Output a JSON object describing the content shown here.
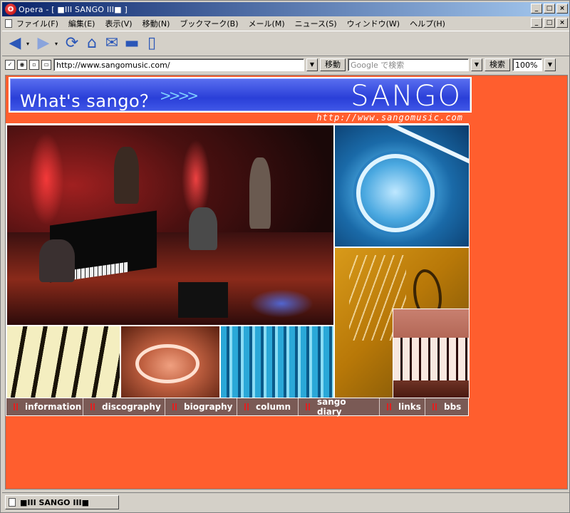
{
  "window": {
    "title": "Opera - [ ■III SANGO III■ ]",
    "controls": [
      "_",
      "□",
      "×"
    ]
  },
  "menu": {
    "items": [
      "ファイル(F)",
      "編集(E)",
      "表示(V)",
      "移動(N)",
      "ブックマーク(B)",
      "メール(M)",
      "ニュース(S)",
      "ウィンドウ(W)",
      "ヘルプ(H)"
    ]
  },
  "toolbar": {
    "icons": [
      "back-icon",
      "forward-icon",
      "reload-icon",
      "home-icon",
      "hotlist-icon",
      "print-icon",
      "page-icon"
    ]
  },
  "addressbar": {
    "url": "http://www.sangomusic.com/",
    "go_label": "移動",
    "search_placeholder": "Google で検索",
    "search_label": "検索",
    "zoom": "100%"
  },
  "page": {
    "banner_tagline": "What's sango？",
    "banner_chevrons": ">>>>",
    "banner_brand": "SANGO",
    "site_url": "http://www.sangomusic.com",
    "nav": [
      "information",
      "discography",
      "biography",
      "column",
      "sango diary",
      "links",
      "bbs"
    ]
  },
  "colors": {
    "page_bg": "#ff5e2e",
    "banner_blue": "#2a3fd8",
    "nav_bg": "#7a5a55",
    "nav_marker": "#e02020"
  },
  "statusbar": {
    "tab_label": "■III SANGO III■"
  }
}
